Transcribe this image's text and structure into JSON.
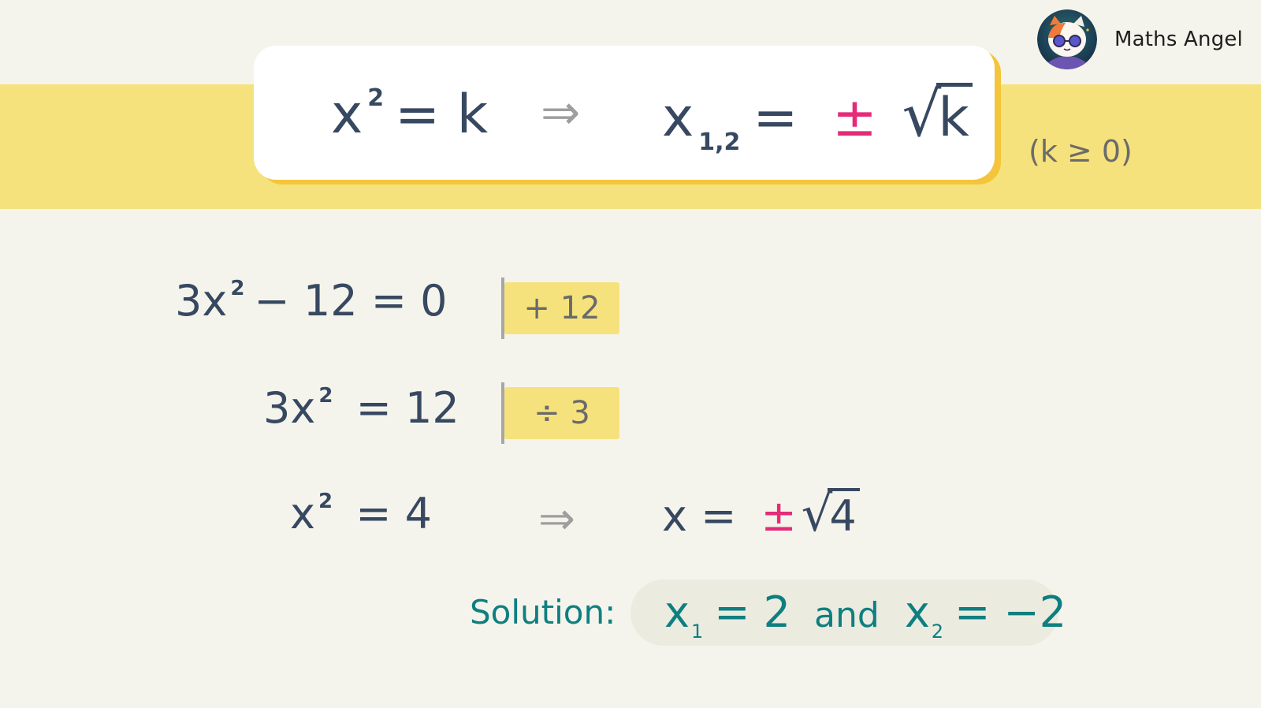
{
  "brand": {
    "name": "Maths Angel",
    "avatar_icon": "cat-with-sunglasses-mascot"
  },
  "colors": {
    "text_dark": "#374861",
    "pink_accent": "#e42b78",
    "teal_accent": "#0e7f80",
    "yellow_band": "#f6e27c",
    "card_shadow": "#f4c53b",
    "background": "#f5f4ec"
  },
  "rule": {
    "lhs_base": "x",
    "lhs_exp": "2",
    "lhs_eq": "=",
    "lhs_rhs": "k",
    "implies": "⇒",
    "rhs_var": "x",
    "rhs_sub": "1,2",
    "rhs_eq": "=",
    "rhs_pm": "±",
    "rhs_root_sign": "√",
    "rhs_radicand": "k",
    "condition": "(k ≥ 0)"
  },
  "steps": [
    {
      "coef": "3x",
      "exp": "2",
      "rest": "− 12  =  0",
      "operation": "+ 12"
    },
    {
      "coef": "3x",
      "exp": "2",
      "rest": " =  12",
      "operation": "÷ 3"
    },
    {
      "coef": "x",
      "exp": "2",
      "rest": " =  4",
      "implies": "⇒",
      "result_var": "x  =",
      "result_pm": "±",
      "result_root_sign": "√",
      "result_radicand": "4"
    }
  ],
  "solution": {
    "label": "Solution:",
    "x1_var": "x",
    "x1_idx": "1",
    "x1_value": "= 2",
    "connector": "and",
    "x2_var": "x",
    "x2_idx": "2",
    "x2_value": "= −2"
  }
}
